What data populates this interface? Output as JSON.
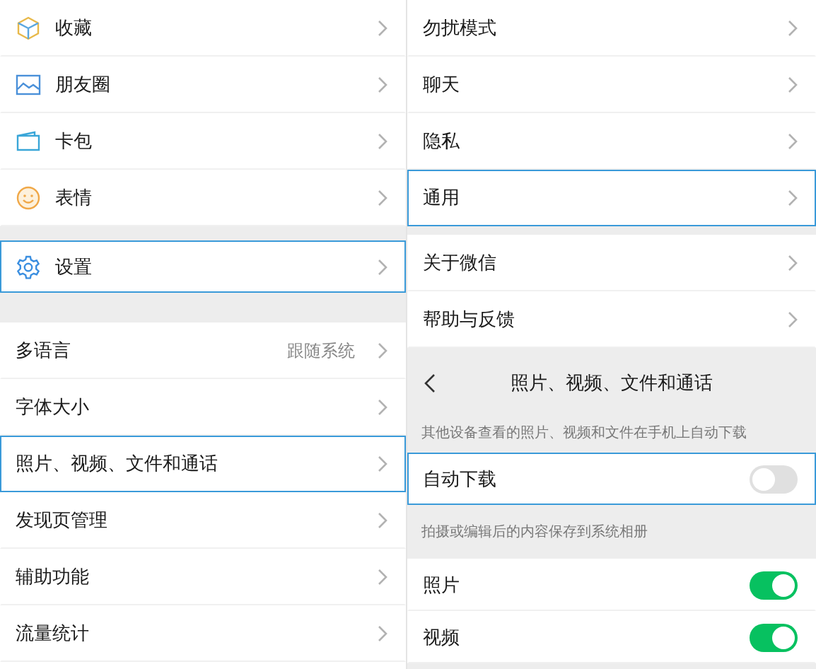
{
  "left": {
    "menu": [
      {
        "label": "收藏",
        "highlighted": false
      },
      {
        "label": "朋友圈",
        "highlighted": false
      },
      {
        "label": "卡包",
        "highlighted": false
      },
      {
        "label": "表情",
        "highlighted": false
      }
    ],
    "settings": {
      "label": "设置",
      "highlighted": true
    },
    "options": [
      {
        "label": "多语言",
        "value": "跟随系统",
        "highlighted": false
      },
      {
        "label": "字体大小",
        "highlighted": false
      },
      {
        "label": "照片、视频、文件和通话",
        "highlighted": true
      },
      {
        "label": "发现页管理",
        "highlighted": false
      },
      {
        "label": "辅助功能",
        "highlighted": false
      },
      {
        "label": "流量统计",
        "highlighted": false
      }
    ]
  },
  "right": {
    "settings": [
      {
        "label": "勿扰模式",
        "highlighted": false
      },
      {
        "label": "聊天",
        "highlighted": false
      },
      {
        "label": "隐私",
        "highlighted": false
      },
      {
        "label": "通用",
        "highlighted": true
      }
    ],
    "about": [
      {
        "label": "关于微信",
        "highlighted": false
      },
      {
        "label": "帮助与反馈",
        "highlighted": false
      }
    ],
    "media_page": {
      "title": "照片、视频、文件和通话",
      "sections": [
        {
          "caption": "其他设备查看的照片、视频和文件在手机上自动下载",
          "rows": [
            {
              "label": "自动下载",
              "on": false,
              "highlighted": true
            }
          ]
        },
        {
          "caption": "拍摄或编辑后的内容保存到系统相册",
          "rows": [
            {
              "label": "照片",
              "on": true,
              "highlighted": false
            },
            {
              "label": "视频",
              "on": true,
              "highlighted": false
            }
          ]
        }
      ]
    }
  }
}
